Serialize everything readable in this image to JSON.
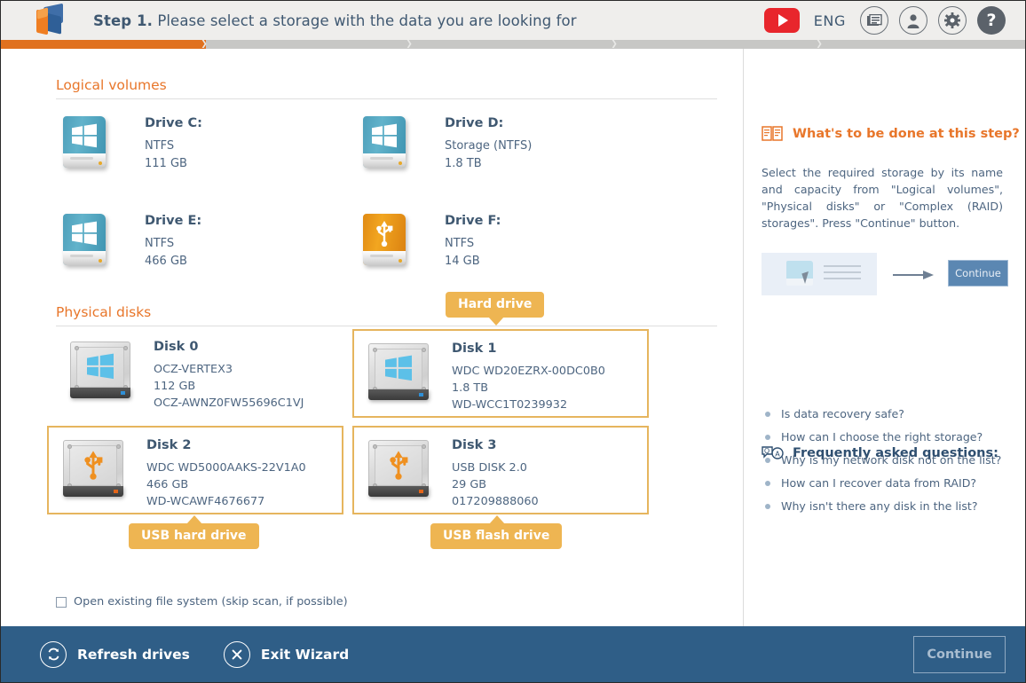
{
  "header": {
    "step_label": "Step 1.",
    "step_text": "Please select a storage with the data you are looking for",
    "youtube_icon": "youtube-icon",
    "language": "ENG",
    "news_icon": "news-icon",
    "account_icon": "account-icon",
    "settings_icon": "gear-icon",
    "help_icon": "question-icon",
    "help_label": "?"
  },
  "progress": {
    "fill_percent": 20,
    "accent_color": "#e0711f",
    "track_color": "#c7c7c5",
    "segments": 5
  },
  "sections": {
    "logical_volumes_title": "Logical volumes",
    "physical_disks_title": "Physical disks"
  },
  "volumes": [
    {
      "name": "Drive C:",
      "fs": "NTFS",
      "size": "111 GB",
      "icon": "windows-volume-icon",
      "kind": "windows"
    },
    {
      "name": "Drive D:",
      "fs": "Storage (NTFS)",
      "size": "1.8 TB",
      "icon": "windows-volume-icon",
      "kind": "windows"
    },
    {
      "name": "Drive E:",
      "fs": "NTFS",
      "size": "466 GB",
      "icon": "windows-volume-icon",
      "kind": "windows"
    },
    {
      "name": "Drive F:",
      "fs": "NTFS",
      "size": "14 GB",
      "icon": "usb-volume-icon",
      "kind": "usb"
    }
  ],
  "disks": [
    {
      "name": "Disk 0",
      "model": "OCZ-VERTEX3",
      "size": "112 GB",
      "serial": "OCZ-AWNZ0FW55696C1VJ",
      "icon": "windows-hdd-icon",
      "kind": "windows",
      "selected": false
    },
    {
      "name": "Disk 1",
      "model": "WDC WD20EZRX-00DC0B0",
      "size": "1.8 TB",
      "serial": "WD-WCC1T0239932",
      "icon": "windows-hdd-icon",
      "kind": "windows",
      "selected": true
    },
    {
      "name": "Disk 2",
      "model": "WDC WD5000AAKS-22V1A0",
      "size": "466 GB",
      "serial": "WD-WCAWF4676677",
      "icon": "usb-hdd-icon",
      "kind": "usb",
      "selected": true
    },
    {
      "name": "Disk 3",
      "model": "USB DISK 2.0",
      "size": "29 GB",
      "serial": "017209888060",
      "icon": "usb-hdd-icon",
      "kind": "usb",
      "selected": true
    }
  ],
  "callouts": {
    "hard_drive": "Hard drive",
    "usb_hard_drive": "USB hard drive",
    "usb_flash_drive": "USB flash drive",
    "color": "#eeb552"
  },
  "checkbox": {
    "label": "Open existing file system (skip scan, if possible)",
    "checked": false
  },
  "sidebar": {
    "step_help_icon": "book-icon",
    "step_help_title": "What's to be done at this step?",
    "step_help_body": "Select the required storage by its name and capacity from \"Logical volumes\", \"Physical disks\" or \"Complex (RAID) storages\". Press \"Continue\" button.",
    "illustration_button": "Continue",
    "faq_icon": "faq-icon",
    "faq_title": "Frequently asked questions:",
    "faq_items": [
      "Is data recovery safe?",
      "How can I choose the right storage?",
      "Why is my network disk not on the list?",
      "How can I recover data from RAID?",
      "Why isn't there any disk in the list?"
    ]
  },
  "footer": {
    "refresh_label": "Refresh drives",
    "refresh_icon": "refresh-icon",
    "exit_label": "Exit Wizard",
    "exit_icon": "close-icon",
    "continue_label": "Continue",
    "bar_color": "#2f5e87"
  }
}
